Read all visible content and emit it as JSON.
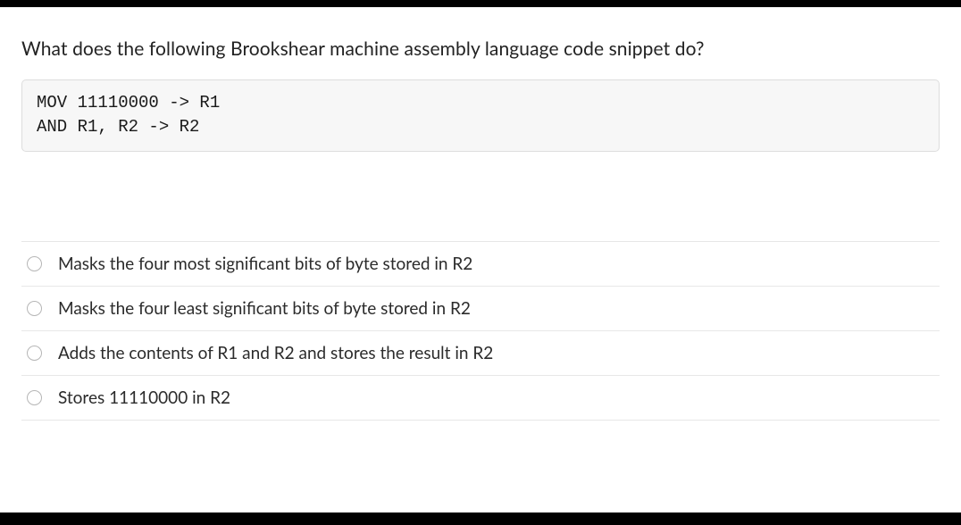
{
  "question": {
    "prompt": "What does the following Brookshear machine assembly language code snippet do?",
    "code": "MOV 11110000 -> R1\nAND R1, R2 -> R2"
  },
  "options": [
    {
      "label": "Masks the four most significant bits of byte stored in R2"
    },
    {
      "label": "Masks the four least significant bits of byte stored in R2"
    },
    {
      "label": "Adds the contents of R1 and R2 and stores the result in R2"
    },
    {
      "label": "Stores 11110000 in R2"
    }
  ]
}
